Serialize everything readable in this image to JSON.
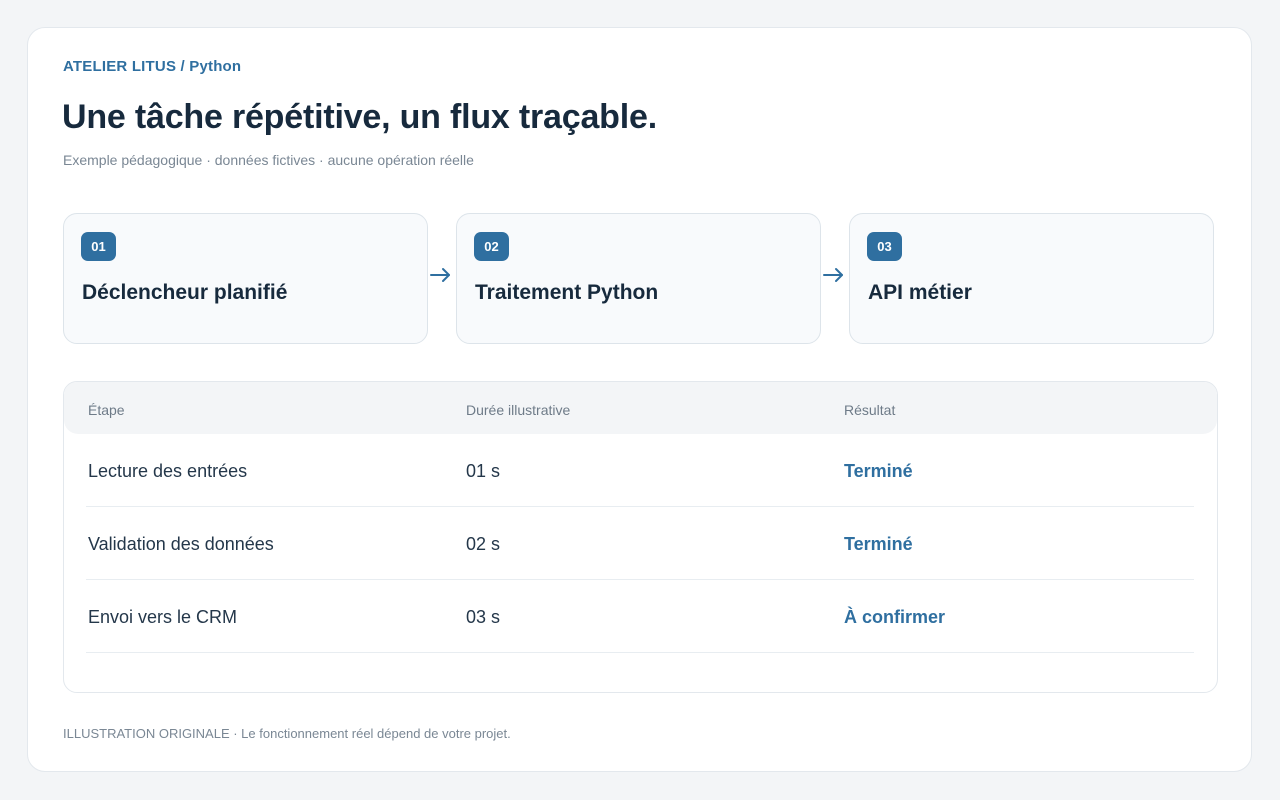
{
  "header": {
    "eyebrow": "ATELIER LITUS / Python",
    "title": "Une tâche répétitive, un flux traçable.",
    "subtitle": "Exemple pédagogique · données fictives · aucune opération réelle"
  },
  "steps": [
    {
      "number": "01",
      "label": "Déclencheur planifié"
    },
    {
      "number": "02",
      "label": "Traitement Python"
    },
    {
      "number": "03",
      "label": "API métier"
    }
  ],
  "table": {
    "columns": [
      "Étape",
      "Durée illustrative",
      "Résultat"
    ],
    "rows": [
      {
        "step": "Lecture des entrées",
        "duration": "01 s",
        "result": "Terminé"
      },
      {
        "step": "Validation des données",
        "duration": "02 s",
        "result": "Terminé"
      },
      {
        "step": "Envoi vers le CRM",
        "duration": "03 s",
        "result": "À confirmer"
      }
    ]
  },
  "footer": "ILLUSTRATION ORIGINALE · Le fonctionnement réel dépend de votre projet.",
  "colors": {
    "accent": "#2f6fa0",
    "heading": "#172a3d",
    "muted": "#7a8794"
  },
  "icons": {
    "flow_arrow": "arrow-right-icon"
  }
}
